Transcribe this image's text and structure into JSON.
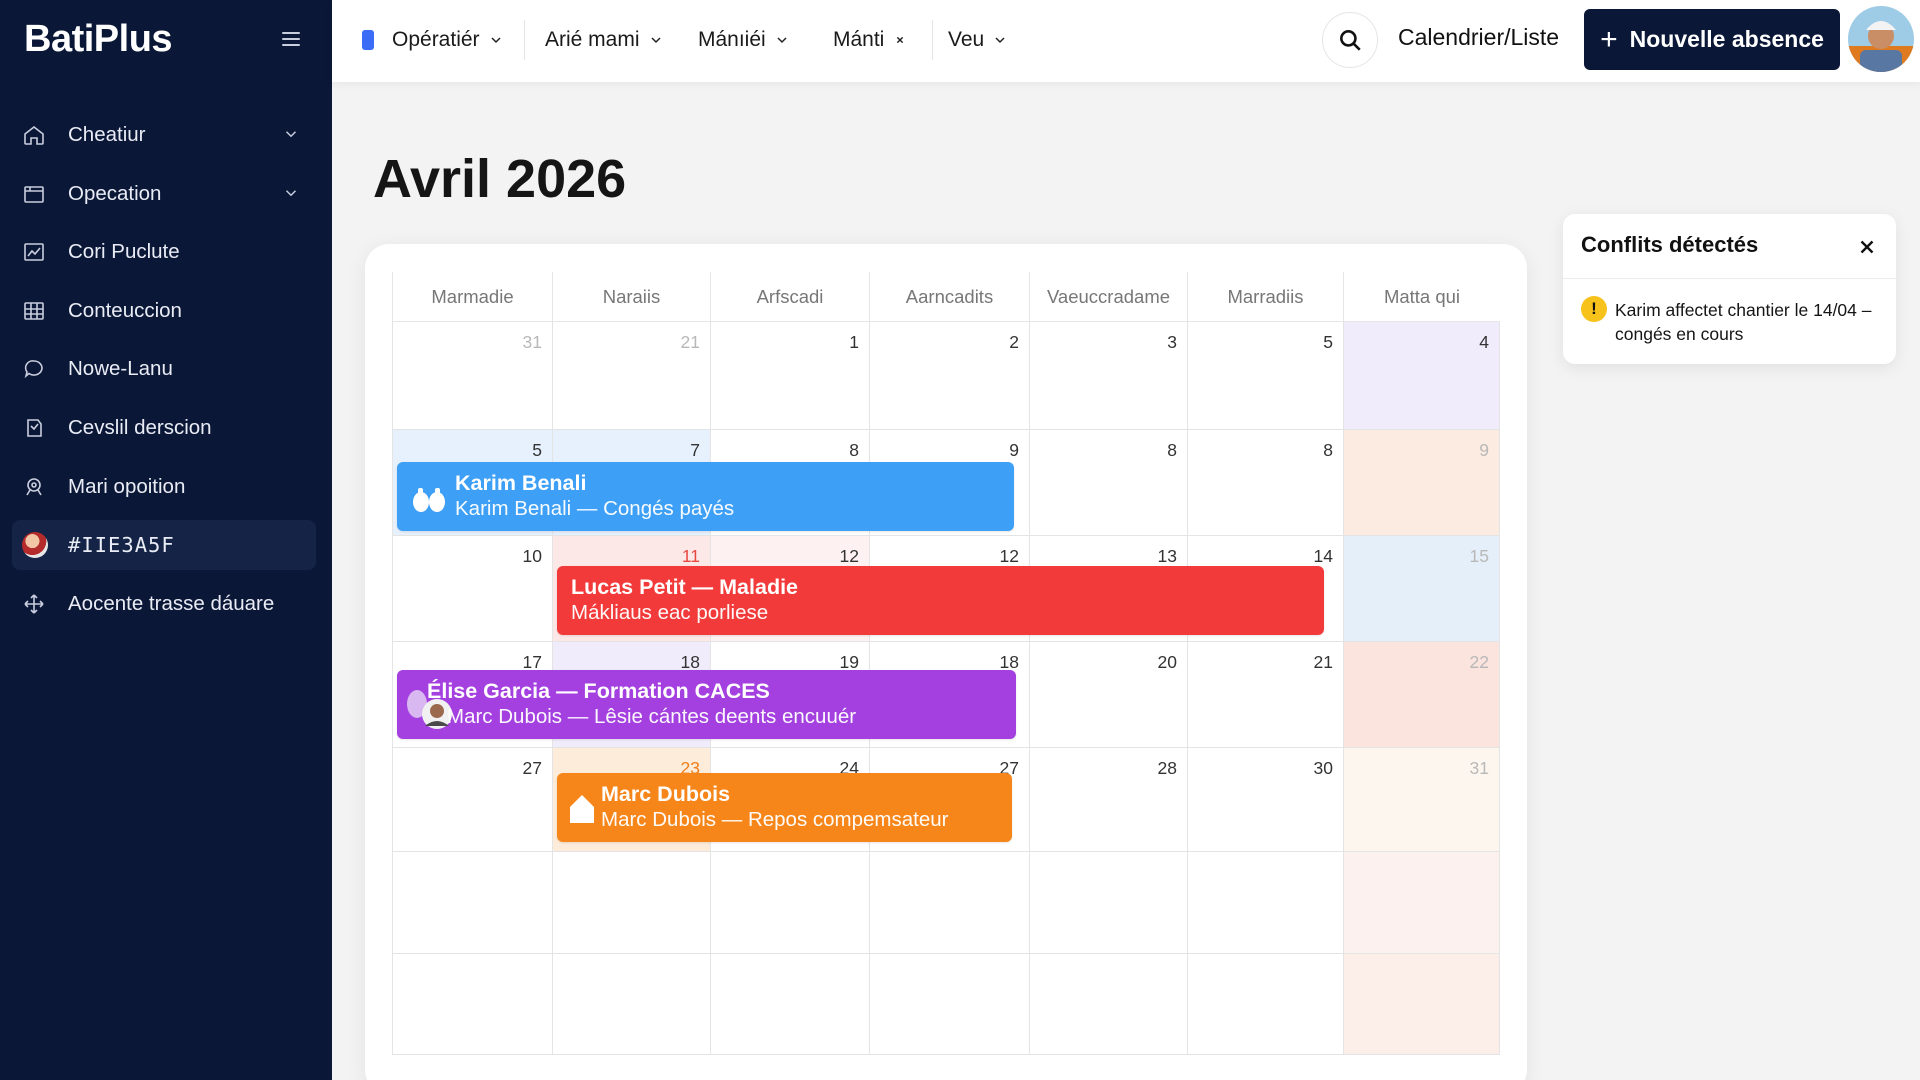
{
  "app": {
    "name": "BatiPlus"
  },
  "sidebar": {
    "items": [
      {
        "label": "Cheatiur",
        "icon": "home-icon",
        "chevron": true
      },
      {
        "label": "Opecation",
        "icon": "folder-icon",
        "chevron": true
      },
      {
        "label": "Cori Puclute",
        "icon": "chart-icon",
        "chevron": false
      },
      {
        "label": "Conteuccion",
        "icon": "grid-icon",
        "chevron": false
      },
      {
        "label": "Nowe-Lanu",
        "icon": "chat-icon",
        "chevron": false
      },
      {
        "label": "Cevslil derscion",
        "icon": "shield-icon",
        "chevron": false
      },
      {
        "label": "Mari opoition",
        "icon": "location-icon",
        "chevron": false
      },
      {
        "label": "#IIE3A5F",
        "icon": "user-avatar",
        "chevron": false,
        "active": true
      },
      {
        "label": "Aocente trasse dáuare",
        "icon": "move-icon",
        "chevron": false
      }
    ]
  },
  "topbar": {
    "filters": [
      "Opératiér",
      "Arié mami",
      "Mánıiéi",
      "Mánti",
      "Veu"
    ],
    "view_toggle": "Calendrier/Liste",
    "new_button": "Nouvelle absence"
  },
  "calendar": {
    "title": "Avril 2026",
    "weekdays": [
      "Marmadie",
      "Naraiis",
      "Arfscadi",
      "Aarncadits",
      "Vaeuccradame",
      "Marradiis",
      "Matta qui"
    ],
    "weeks": [
      [
        "31",
        "21",
        "1",
        "2",
        "3",
        "5",
        "4"
      ],
      [
        "5",
        "7",
        "8",
        "9",
        "8",
        "8",
        "9"
      ],
      [
        "10",
        "11",
        "12",
        "12",
        "13",
        "14",
        "15"
      ],
      [
        "17",
        "18",
        "19",
        "18",
        "20",
        "21",
        "22"
      ],
      [
        "27",
        "23",
        "24",
        "27",
        "28",
        "30",
        "31"
      ],
      [
        "",
        "",
        "",
        "",
        "",
        "",
        ""
      ],
      [
        "",
        "",
        "",
        "",
        "",
        "",
        ""
      ]
    ],
    "events": [
      {
        "title": "Karim Benali",
        "subtitle": "Karim Benali — Congés payés",
        "color": "#3d9ff5",
        "icon": "hands-icon"
      },
      {
        "title": "Lucas Petit — Maladie",
        "subtitle": "Mákliaus eac porliese",
        "color": "#f23a3a"
      },
      {
        "title": "Élise Garcia — Formation CACES",
        "subtitle": "Marc Dubois — Lêsie cántes deents encuuér",
        "color": "#a43fe0",
        "icon": "person-avatar"
      },
      {
        "title": "Marc Dubois",
        "subtitle": "Marc Dubois — Repos compemsateur",
        "color": "#f7861a",
        "icon": "house-icon"
      }
    ]
  },
  "conflicts": {
    "title": "Conflits détectés",
    "message": "Karim affectet chantier le 14/04 – congés en cours",
    "warning_badge": "!"
  },
  "colors": {
    "sidebar_bg": "#0b1736",
    "primary_button": "#0b1736",
    "accent_blue": "#3d9ff5",
    "accent_red": "#f23a3a",
    "accent_purple": "#a43fe0",
    "accent_orange": "#f7861a"
  }
}
